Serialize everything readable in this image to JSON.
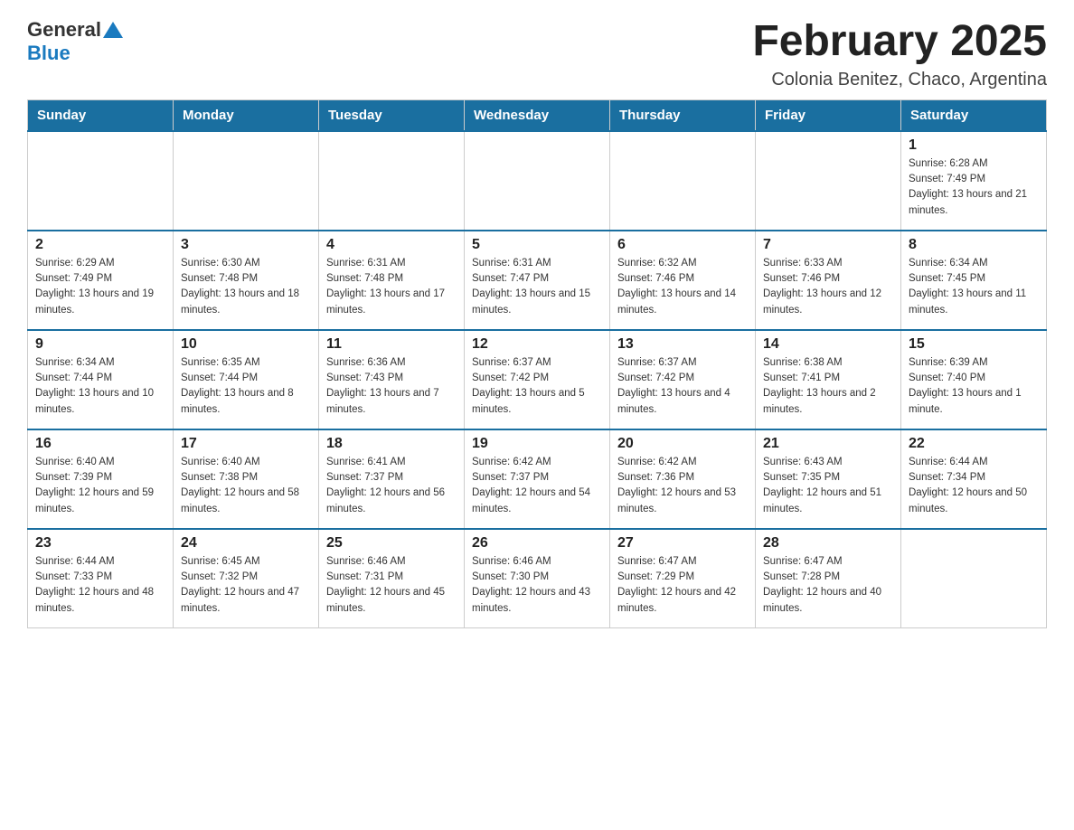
{
  "header": {
    "logo": {
      "general": "General",
      "blue": "Blue"
    },
    "title": "February 2025",
    "subtitle": "Colonia Benitez, Chaco, Argentina"
  },
  "weekdays": [
    "Sunday",
    "Monday",
    "Tuesday",
    "Wednesday",
    "Thursday",
    "Friday",
    "Saturday"
  ],
  "weeks": [
    [
      {
        "day": "",
        "info": ""
      },
      {
        "day": "",
        "info": ""
      },
      {
        "day": "",
        "info": ""
      },
      {
        "day": "",
        "info": ""
      },
      {
        "day": "",
        "info": ""
      },
      {
        "day": "",
        "info": ""
      },
      {
        "day": "1",
        "info": "Sunrise: 6:28 AM\nSunset: 7:49 PM\nDaylight: 13 hours and 21 minutes."
      }
    ],
    [
      {
        "day": "2",
        "info": "Sunrise: 6:29 AM\nSunset: 7:49 PM\nDaylight: 13 hours and 19 minutes."
      },
      {
        "day": "3",
        "info": "Sunrise: 6:30 AM\nSunset: 7:48 PM\nDaylight: 13 hours and 18 minutes."
      },
      {
        "day": "4",
        "info": "Sunrise: 6:31 AM\nSunset: 7:48 PM\nDaylight: 13 hours and 17 minutes."
      },
      {
        "day": "5",
        "info": "Sunrise: 6:31 AM\nSunset: 7:47 PM\nDaylight: 13 hours and 15 minutes."
      },
      {
        "day": "6",
        "info": "Sunrise: 6:32 AM\nSunset: 7:46 PM\nDaylight: 13 hours and 14 minutes."
      },
      {
        "day": "7",
        "info": "Sunrise: 6:33 AM\nSunset: 7:46 PM\nDaylight: 13 hours and 12 minutes."
      },
      {
        "day": "8",
        "info": "Sunrise: 6:34 AM\nSunset: 7:45 PM\nDaylight: 13 hours and 11 minutes."
      }
    ],
    [
      {
        "day": "9",
        "info": "Sunrise: 6:34 AM\nSunset: 7:44 PM\nDaylight: 13 hours and 10 minutes."
      },
      {
        "day": "10",
        "info": "Sunrise: 6:35 AM\nSunset: 7:44 PM\nDaylight: 13 hours and 8 minutes."
      },
      {
        "day": "11",
        "info": "Sunrise: 6:36 AM\nSunset: 7:43 PM\nDaylight: 13 hours and 7 minutes."
      },
      {
        "day": "12",
        "info": "Sunrise: 6:37 AM\nSunset: 7:42 PM\nDaylight: 13 hours and 5 minutes."
      },
      {
        "day": "13",
        "info": "Sunrise: 6:37 AM\nSunset: 7:42 PM\nDaylight: 13 hours and 4 minutes."
      },
      {
        "day": "14",
        "info": "Sunrise: 6:38 AM\nSunset: 7:41 PM\nDaylight: 13 hours and 2 minutes."
      },
      {
        "day": "15",
        "info": "Sunrise: 6:39 AM\nSunset: 7:40 PM\nDaylight: 13 hours and 1 minute."
      }
    ],
    [
      {
        "day": "16",
        "info": "Sunrise: 6:40 AM\nSunset: 7:39 PM\nDaylight: 12 hours and 59 minutes."
      },
      {
        "day": "17",
        "info": "Sunrise: 6:40 AM\nSunset: 7:38 PM\nDaylight: 12 hours and 58 minutes."
      },
      {
        "day": "18",
        "info": "Sunrise: 6:41 AM\nSunset: 7:37 PM\nDaylight: 12 hours and 56 minutes."
      },
      {
        "day": "19",
        "info": "Sunrise: 6:42 AM\nSunset: 7:37 PM\nDaylight: 12 hours and 54 minutes."
      },
      {
        "day": "20",
        "info": "Sunrise: 6:42 AM\nSunset: 7:36 PM\nDaylight: 12 hours and 53 minutes."
      },
      {
        "day": "21",
        "info": "Sunrise: 6:43 AM\nSunset: 7:35 PM\nDaylight: 12 hours and 51 minutes."
      },
      {
        "day": "22",
        "info": "Sunrise: 6:44 AM\nSunset: 7:34 PM\nDaylight: 12 hours and 50 minutes."
      }
    ],
    [
      {
        "day": "23",
        "info": "Sunrise: 6:44 AM\nSunset: 7:33 PM\nDaylight: 12 hours and 48 minutes."
      },
      {
        "day": "24",
        "info": "Sunrise: 6:45 AM\nSunset: 7:32 PM\nDaylight: 12 hours and 47 minutes."
      },
      {
        "day": "25",
        "info": "Sunrise: 6:46 AM\nSunset: 7:31 PM\nDaylight: 12 hours and 45 minutes."
      },
      {
        "day": "26",
        "info": "Sunrise: 6:46 AM\nSunset: 7:30 PM\nDaylight: 12 hours and 43 minutes."
      },
      {
        "day": "27",
        "info": "Sunrise: 6:47 AM\nSunset: 7:29 PM\nDaylight: 12 hours and 42 minutes."
      },
      {
        "day": "28",
        "info": "Sunrise: 6:47 AM\nSunset: 7:28 PM\nDaylight: 12 hours and 40 minutes."
      },
      {
        "day": "",
        "info": ""
      }
    ]
  ]
}
